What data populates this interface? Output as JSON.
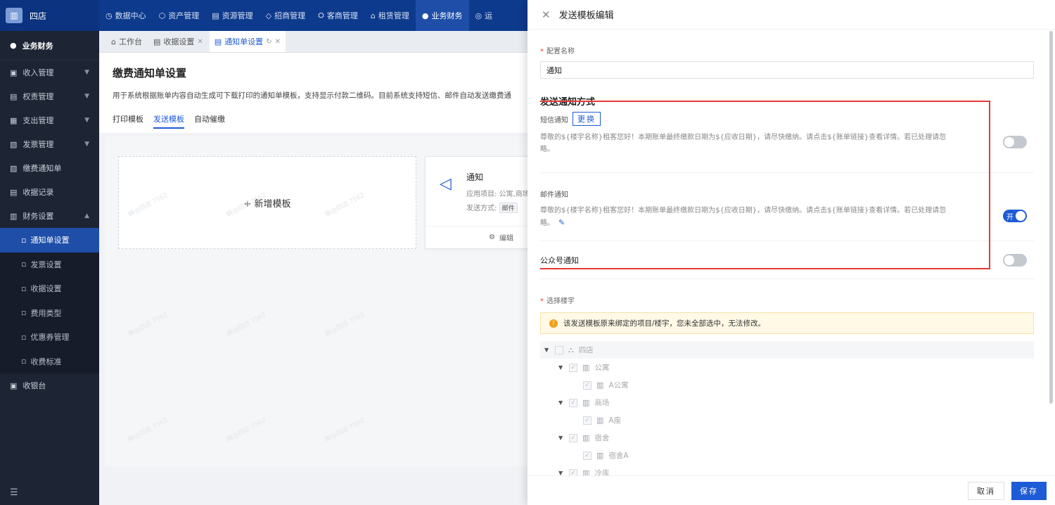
{
  "topnav": {
    "logo_text": "四店",
    "items": [
      {
        "icon": "◷",
        "label": "数据中心"
      },
      {
        "icon": "⬡",
        "label": "资产管理"
      },
      {
        "icon": "▤",
        "label": "资源管理"
      },
      {
        "icon": "◇",
        "label": "招商管理"
      },
      {
        "icon": "⛭",
        "label": "客商管理"
      },
      {
        "icon": "⌂",
        "label": "租赁管理"
      },
      {
        "icon": "●",
        "label": "业务财务"
      },
      {
        "icon": "◎",
        "label": "运"
      }
    ],
    "active_index": 6
  },
  "sidebar": {
    "header": "业务财务",
    "items": [
      {
        "label": "收入管理",
        "expandable": true
      },
      {
        "label": "权责管理",
        "expandable": true
      },
      {
        "label": "支出管理",
        "expandable": true
      },
      {
        "label": "发票管理",
        "expandable": true
      },
      {
        "label": "缴费通知单",
        "expandable": false
      },
      {
        "label": "收据记录",
        "expandable": false
      },
      {
        "label": "财务设置",
        "expandable": true
      }
    ],
    "subitems": [
      {
        "label": "通知单设置"
      },
      {
        "label": "发票设置"
      },
      {
        "label": "收据设置"
      },
      {
        "label": "费用类型"
      },
      {
        "label": "优惠券管理"
      },
      {
        "label": "收费标准"
      }
    ],
    "active_sub_index": 0,
    "last_item": "收银台"
  },
  "tabs": [
    {
      "label": "工作台",
      "closable": false
    },
    {
      "label": "收据设置",
      "closable": true
    },
    {
      "label": "通知单设置",
      "closable": true
    }
  ],
  "page": {
    "title": "缴费通知单设置",
    "desc": "用于系统根据账单内容自动生成可下载打印的通知单模板，支持显示付款二维码。目前系统支持短信、邮件自动发送缴费通",
    "subtabs": [
      "打印模板",
      "发送模板",
      "自动催缴"
    ],
    "active_subtab": 1,
    "add_card_label": "+ 新增模板",
    "card": {
      "title": "通知",
      "project_label": "应用项目: 公寓,商场",
      "method_label": "发送方式:",
      "method_tag": "邮件",
      "edit_label": "编辑"
    },
    "watermark": "瞬@四店 7562"
  },
  "drawer": {
    "title": "发送模板编辑",
    "config_name_label": "配置名称",
    "config_name_value": "通知",
    "send_method_title": "发送通知方式",
    "sms": {
      "label": "短信通知",
      "change_btn": "更换",
      "text": "尊敬的${楼宇名称}租客您好！本期账单最终缴款日期为${应收日期}，请尽快缴纳。请点击${账单链接}查看详情。若已处理请忽略。",
      "enabled": false
    },
    "email": {
      "label": "邮件通知",
      "text": "尊敬的${楼宇名称}租客您好！本期账单最终缴款日期为${应收日期}，请尽快缴纳。请点击${账单链接}查看详情。若已处理请忽略。",
      "enabled": true,
      "toggle_text": "开"
    },
    "wechat": {
      "label": "公众号通知",
      "enabled": false
    },
    "building_label": "选择楼宇",
    "alert": "该发送模板原来绑定的项目/楼宇，您未全部选中，无法修改。",
    "tree": [
      {
        "level": 0,
        "label": "四店",
        "caret": true,
        "checked": false
      },
      {
        "level": 1,
        "label": "公寓",
        "caret": true,
        "checked": true
      },
      {
        "level": 2,
        "label": "A公寓",
        "caret": false,
        "checked": true
      },
      {
        "level": 1,
        "label": "商场",
        "caret": true,
        "checked": true
      },
      {
        "level": 2,
        "label": "A座",
        "caret": false,
        "checked": true
      },
      {
        "level": 1,
        "label": "宿舍",
        "caret": true,
        "checked": true
      },
      {
        "level": 2,
        "label": "宿舍A",
        "caret": false,
        "checked": true
      },
      {
        "level": 1,
        "label": "冷库",
        "caret": true,
        "checked": true
      }
    ],
    "cancel_label": "取消",
    "save_label": "保存"
  },
  "colors": {
    "primary": "#1e5bd6",
    "topnav": "#0d3a8c",
    "sidebar": "#1d2433",
    "highlight_box": "#e53935"
  }
}
